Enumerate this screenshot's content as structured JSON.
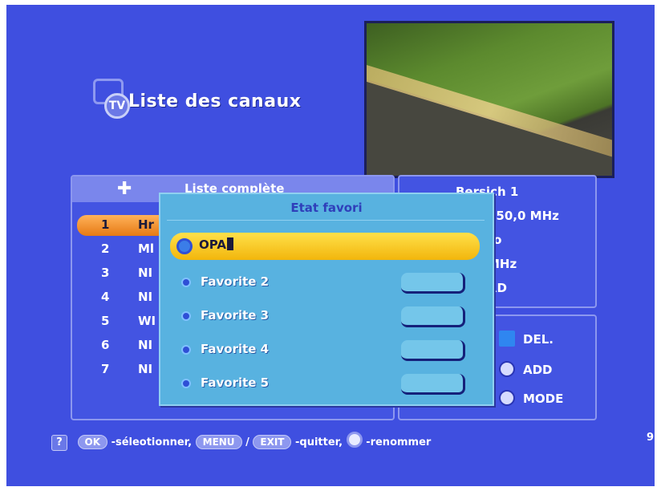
{
  "header": {
    "icon_text": "TV",
    "title": "Liste des canaux"
  },
  "channel_list": {
    "title": "Liste complète",
    "channels": [
      {
        "number": "1",
        "name": "Hr"
      },
      {
        "number": "2",
        "name": "Ml"
      },
      {
        "number": "3",
        "name": "NI"
      },
      {
        "number": "4",
        "name": "NI"
      },
      {
        "number": "5",
        "name": "WI"
      },
      {
        "number": "6",
        "name": "NI"
      },
      {
        "number": "7",
        "name": "NI"
      }
    ],
    "selected_index": 0
  },
  "info": {
    "lines": [
      "Bersich 1",
      "550,0 MHz",
      "to",
      "MHz",
      "RD"
    ]
  },
  "legend": {
    "items": [
      {
        "key": "blue-square",
        "label": "DEL."
      },
      {
        "key": "circle-button",
        "label": "ADD"
      },
      {
        "key": "circle-button",
        "label": "MODE"
      }
    ]
  },
  "popup": {
    "title": "Etat favori",
    "favorites": [
      {
        "label": "OPA",
        "active": true
      },
      {
        "label": "Favorite 2",
        "active": false
      },
      {
        "label": "Favorite 3",
        "active": false
      },
      {
        "label": "Favorite 4",
        "active": false
      },
      {
        "label": "Favorite 5",
        "active": false
      }
    ]
  },
  "footer": {
    "ok_key": "OK",
    "ok_text": "-séleotionner,",
    "menu_key": "MENU",
    "slash": "/",
    "exit_key": "EXIT",
    "exit_text": "-quitter,",
    "rename_text": "-renommer",
    "corner": "9"
  },
  "colors": {
    "background": "#3f4fe0",
    "popup": "#58b2e0",
    "highlight_orange": "#f0902a",
    "highlight_yellow": "#f5c518"
  }
}
